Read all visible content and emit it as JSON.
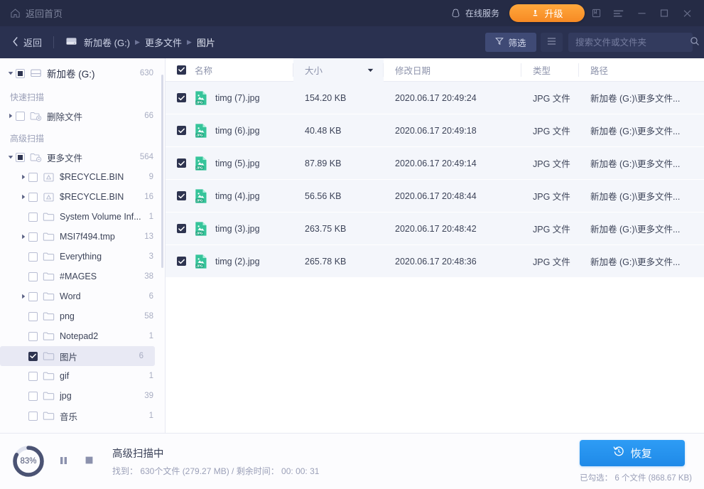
{
  "titlebar": {
    "home_label": "返回首页",
    "home_icon": "home-icon",
    "service_label": "在线服务",
    "service_icon": "headset-icon",
    "upgrade_label": "升级",
    "upgrade_icon": "crown-icon",
    "icons": [
      "book-icon",
      "menu-icon",
      "minimize-icon",
      "maximize-icon",
      "close-icon"
    ],
    "bg": "#252b45"
  },
  "navbar": {
    "back_label": "返回",
    "back_icon": "chevron-left-icon",
    "drive_icon": "drive-icon",
    "breadcrumbs": [
      "新加卷 (G:)",
      "更多文件",
      "图片"
    ],
    "filter_label": "筛选",
    "filter_icon": "funnel-icon",
    "view_icon": "list-view-icon",
    "search_placeholder": "搜索文件或文件夹",
    "search_value": "",
    "search_icon": "search-icon",
    "bg": "#2a3150"
  },
  "sidebar": {
    "root": {
      "name": "新加卷 (G:)",
      "count": "630",
      "icon": "drive-icon",
      "check": "partial",
      "expanded": true
    },
    "groups": [
      {
        "label": "快速扫描",
        "items": [
          {
            "name": "删除文件",
            "count": "66",
            "icon": "folder-deleted-icon",
            "check": "unchecked",
            "indent": 0,
            "arrow": "collapsed"
          }
        ]
      },
      {
        "label": "高级扫描",
        "items": [
          {
            "name": "更多文件",
            "count": "564",
            "icon": "folder-more-icon",
            "check": "partial",
            "indent": 0,
            "arrow": "expanded"
          },
          {
            "name": "$RECYCLE.BIN",
            "count": "9",
            "icon": "recycle-icon",
            "check": "unchecked",
            "indent": 1,
            "arrow": "collapsed"
          },
          {
            "name": "$RECYCLE.BIN",
            "count": "16",
            "icon": "recycle-icon",
            "check": "unchecked",
            "indent": 1,
            "arrow": "collapsed"
          },
          {
            "name": "System Volume Inf...",
            "count": "1",
            "icon": "folder-icon",
            "check": "unchecked",
            "indent": 1,
            "arrow": "none"
          },
          {
            "name": "MSI7f494.tmp",
            "count": "13",
            "icon": "folder-icon",
            "check": "unchecked",
            "indent": 1,
            "arrow": "collapsed"
          },
          {
            "name": "Everything",
            "count": "3",
            "icon": "folder-icon",
            "check": "unchecked",
            "indent": 1,
            "arrow": "none"
          },
          {
            "name": "#MAGES",
            "count": "38",
            "icon": "folder-icon",
            "check": "unchecked",
            "indent": 1,
            "arrow": "none"
          },
          {
            "name": "Word",
            "count": "6",
            "icon": "folder-icon",
            "check": "unchecked",
            "indent": 1,
            "arrow": "collapsed"
          },
          {
            "name": "png",
            "count": "58",
            "icon": "folder-icon",
            "check": "unchecked",
            "indent": 1,
            "arrow": "none"
          },
          {
            "name": "Notepad2",
            "count": "1",
            "icon": "folder-icon",
            "check": "unchecked",
            "indent": 1,
            "arrow": "none"
          },
          {
            "name": "图片",
            "count": "6",
            "icon": "folder-icon",
            "check": "checked",
            "indent": 1,
            "arrow": "none",
            "selected": true
          },
          {
            "name": "gif",
            "count": "1",
            "icon": "folder-icon",
            "check": "unchecked",
            "indent": 1,
            "arrow": "none"
          },
          {
            "name": "jpg",
            "count": "39",
            "icon": "folder-icon",
            "check": "unchecked",
            "indent": 1,
            "arrow": "none"
          },
          {
            "name": "音乐",
            "count": "1",
            "icon": "folder-icon",
            "check": "unchecked",
            "indent": 1,
            "arrow": "none"
          }
        ]
      }
    ]
  },
  "table": {
    "select_all_checked": true,
    "columns": [
      {
        "key": "name",
        "label": "名称"
      },
      {
        "key": "size",
        "label": "大小",
        "sorted": true,
        "sort_icon": "caret-down-icon"
      },
      {
        "key": "date",
        "label": "修改日期"
      },
      {
        "key": "type",
        "label": "类型"
      },
      {
        "key": "path",
        "label": "路径"
      }
    ],
    "rows": [
      {
        "checked": true,
        "icon": "jpg-file-icon",
        "name": "timg (7).jpg",
        "size": "154.20 KB",
        "date": "2020.06.17 20:49:24",
        "type": "JPG 文件",
        "path": "新加卷 (G:)\\更多文件..."
      },
      {
        "checked": true,
        "icon": "jpg-file-icon",
        "name": "timg (6).jpg",
        "size": "40.48 KB",
        "date": "2020.06.17 20:49:18",
        "type": "JPG 文件",
        "path": "新加卷 (G:)\\更多文件..."
      },
      {
        "checked": true,
        "icon": "jpg-file-icon",
        "name": "timg (5).jpg",
        "size": "87.89 KB",
        "date": "2020.06.17 20:49:14",
        "type": "JPG 文件",
        "path": "新加卷 (G:)\\更多文件..."
      },
      {
        "checked": true,
        "icon": "jpg-file-icon",
        "name": "timg (4).jpg",
        "size": "56.56 KB",
        "date": "2020.06.17 20:48:44",
        "type": "JPG 文件",
        "path": "新加卷 (G:)\\更多文件..."
      },
      {
        "checked": true,
        "icon": "jpg-file-icon",
        "name": "timg (3).jpg",
        "size": "263.75 KB",
        "date": "2020.06.17 20:48:42",
        "type": "JPG 文件",
        "path": "新加卷 (G:)\\更多文件..."
      },
      {
        "checked": true,
        "icon": "jpg-file-icon",
        "name": "timg (2).jpg",
        "size": "265.78 KB",
        "date": "2020.06.17 20:48:36",
        "type": "JPG 文件",
        "path": "新加卷 (G:)\\更多文件..."
      }
    ]
  },
  "footer": {
    "progress_percent": "83%",
    "progress_value": 83,
    "pause_icon": "pause-icon",
    "stop_icon": "stop-icon",
    "status_title": "高级扫描中",
    "status_sub": "找到： 630个文件 (279.27 MB) / 剩余时间： 00: 00: 31",
    "recover_label": "恢复",
    "recover_icon": "restore-clock-icon",
    "selected_info": "已勾选： 6 个文件 (868.67 KB)",
    "accent": "#1f8ae8"
  }
}
